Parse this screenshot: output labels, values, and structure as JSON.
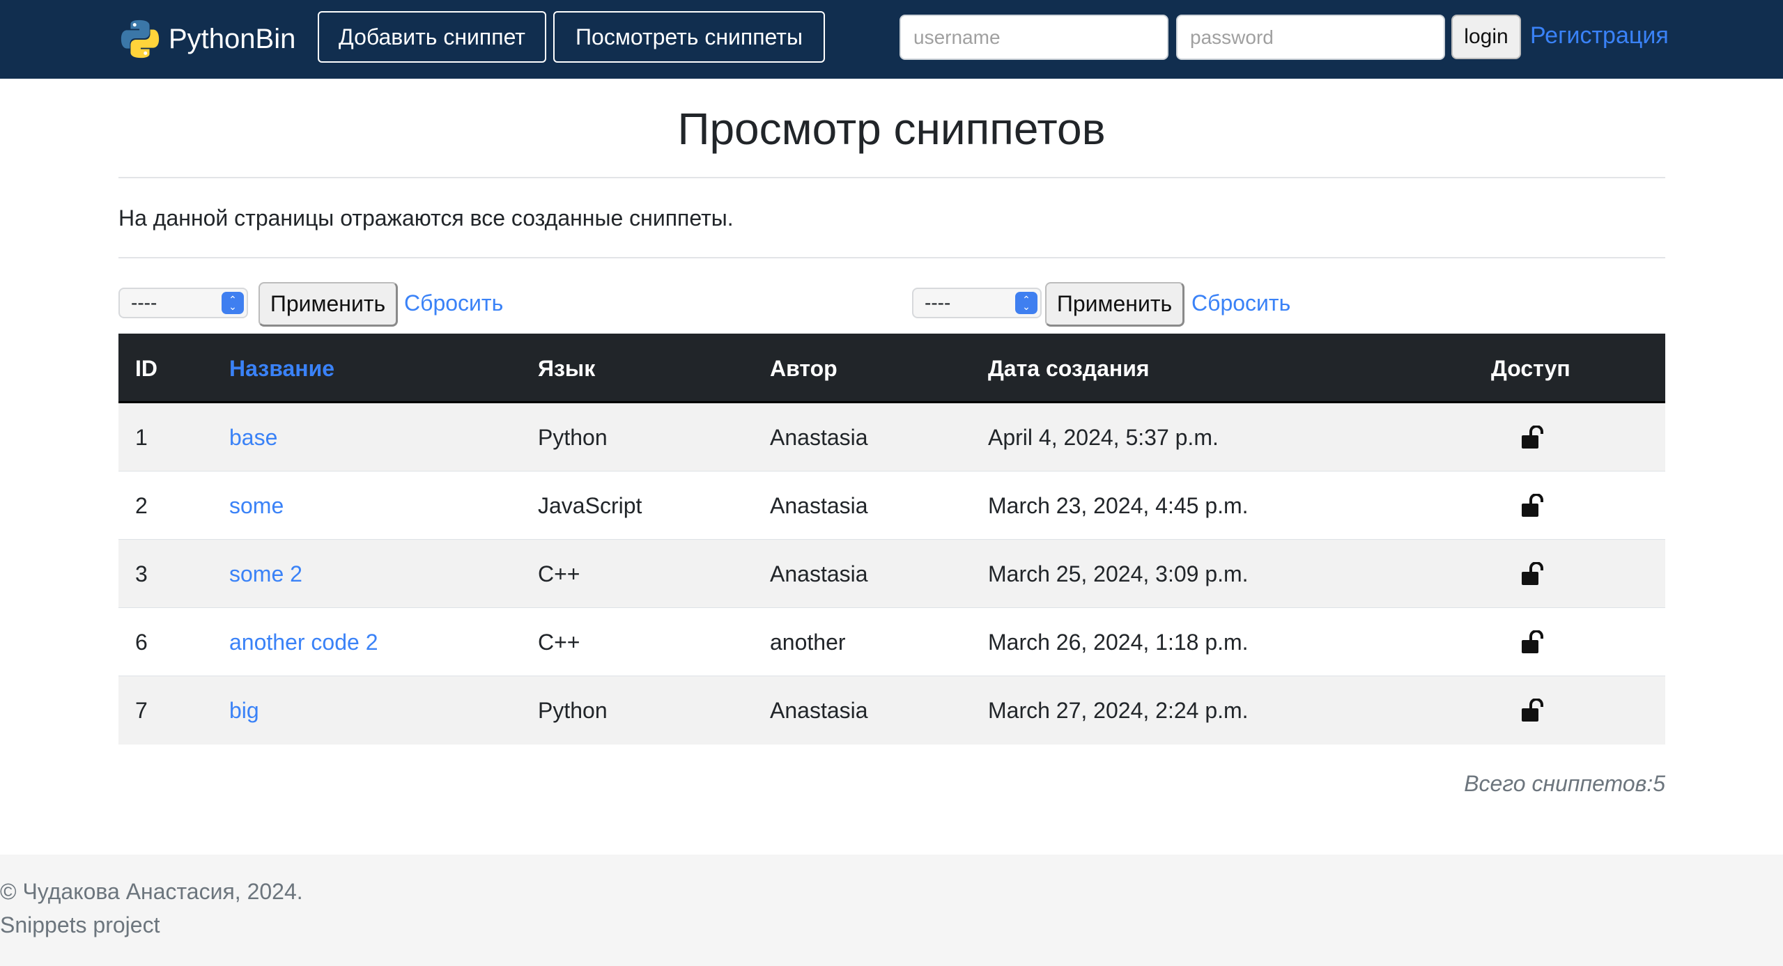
{
  "header": {
    "brand": "PythonBin",
    "add_snippet": "Добавить сниппет",
    "view_snippets": "Посмотреть сниппеты",
    "username_placeholder": "username",
    "password_placeholder": "password",
    "login": "login",
    "register": "Регистрация"
  },
  "main": {
    "title": "Просмотр сниппетов",
    "intro": "На данной страницы отражаются все созданные сниппеты.",
    "filters": [
      {
        "select_value": "----",
        "apply": "Применить",
        "reset": "Сбросить"
      },
      {
        "select_value": "----",
        "apply": "Применить",
        "reset": "Сбросить"
      }
    ],
    "table": {
      "headers": {
        "id": "ID",
        "name": "Название",
        "language": "Язык",
        "author": "Автор",
        "created": "Дата создания",
        "access": "Доступ"
      },
      "rows": [
        {
          "id": "1",
          "name": "base",
          "language": "Python",
          "author": "Anastasia",
          "created": "April 4, 2024, 5:37 p.m.",
          "access_icon": "unlock-icon"
        },
        {
          "id": "2",
          "name": "some",
          "language": "JavaScript",
          "author": "Anastasia",
          "created": "March 23, 2024, 4:45 p.m.",
          "access_icon": "unlock-icon"
        },
        {
          "id": "3",
          "name": "some 2",
          "language": "C++",
          "author": "Anastasia",
          "created": "March 25, 2024, 3:09 p.m.",
          "access_icon": "unlock-icon"
        },
        {
          "id": "6",
          "name": "another code 2",
          "language": "C++",
          "author": "another",
          "created": "March 26, 2024, 1:18 p.m.",
          "access_icon": "unlock-icon"
        },
        {
          "id": "7",
          "name": "big",
          "language": "Python",
          "author": "Anastasia",
          "created": "March 27, 2024, 2:24 p.m.",
          "access_icon": "unlock-icon"
        }
      ]
    },
    "total": "Всего сниппетов:5"
  },
  "footer": {
    "copyright": "© Чудакова Анастасия, 2024.",
    "project": "Snippets project"
  },
  "colors": {
    "navbar": "#112e4f",
    "link": "#3a82f7",
    "table_header": "#212529",
    "select_accent": "#3f7ff0"
  }
}
